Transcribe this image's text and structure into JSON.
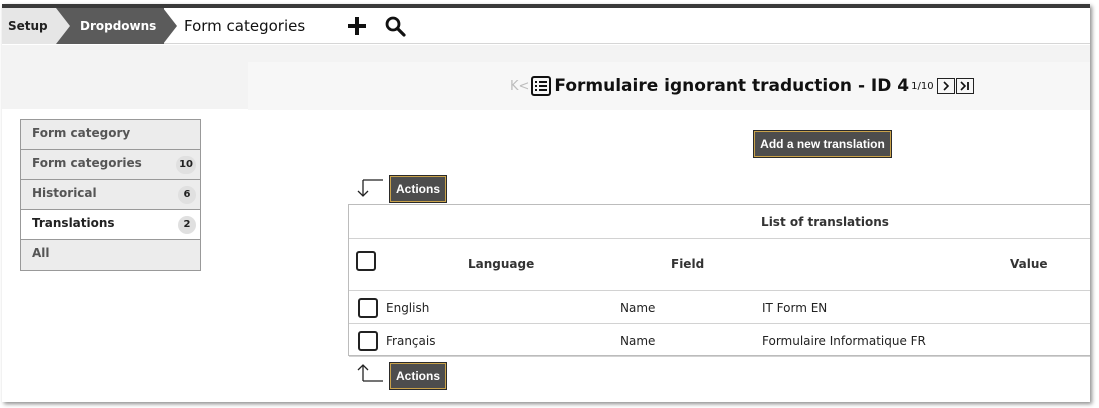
{
  "breadcrumb": {
    "items": [
      "Setup",
      "Dropdowns"
    ],
    "current": "Form categories"
  },
  "toolbar": {
    "add_icon": "plus-icon",
    "search_icon": "search-icon"
  },
  "record": {
    "first_glyph": "K<",
    "title": "Formulaire ignorant traduction - ID 4",
    "counter": "1/10",
    "list_icon": "list-icon",
    "next_icon": "next-icon",
    "last_icon": "last-icon"
  },
  "tabs": [
    {
      "label": "Form category",
      "badge": ""
    },
    {
      "label": "Form categories",
      "badge": "10"
    },
    {
      "label": "Historical",
      "badge": "6"
    },
    {
      "label": "Translations",
      "badge": "2"
    },
    {
      "label": "All",
      "badge": ""
    }
  ],
  "active_tab": "Translations",
  "add_translation_label": "Add a new translation",
  "actions_label": "Actions",
  "table": {
    "caption": "List of translations",
    "columns": [
      "Language",
      "Field",
      "Value"
    ],
    "rows": [
      {
        "language": "English",
        "field": "Name",
        "value": "IT Form EN"
      },
      {
        "language": "Français",
        "field": "Name",
        "value": "Formulaire Informatique FR"
      }
    ]
  },
  "colors": {
    "breadcrumb_dark": "#5b5b5b",
    "button_dark": "#4d4d4d",
    "button_outline": "#c9a24a"
  }
}
